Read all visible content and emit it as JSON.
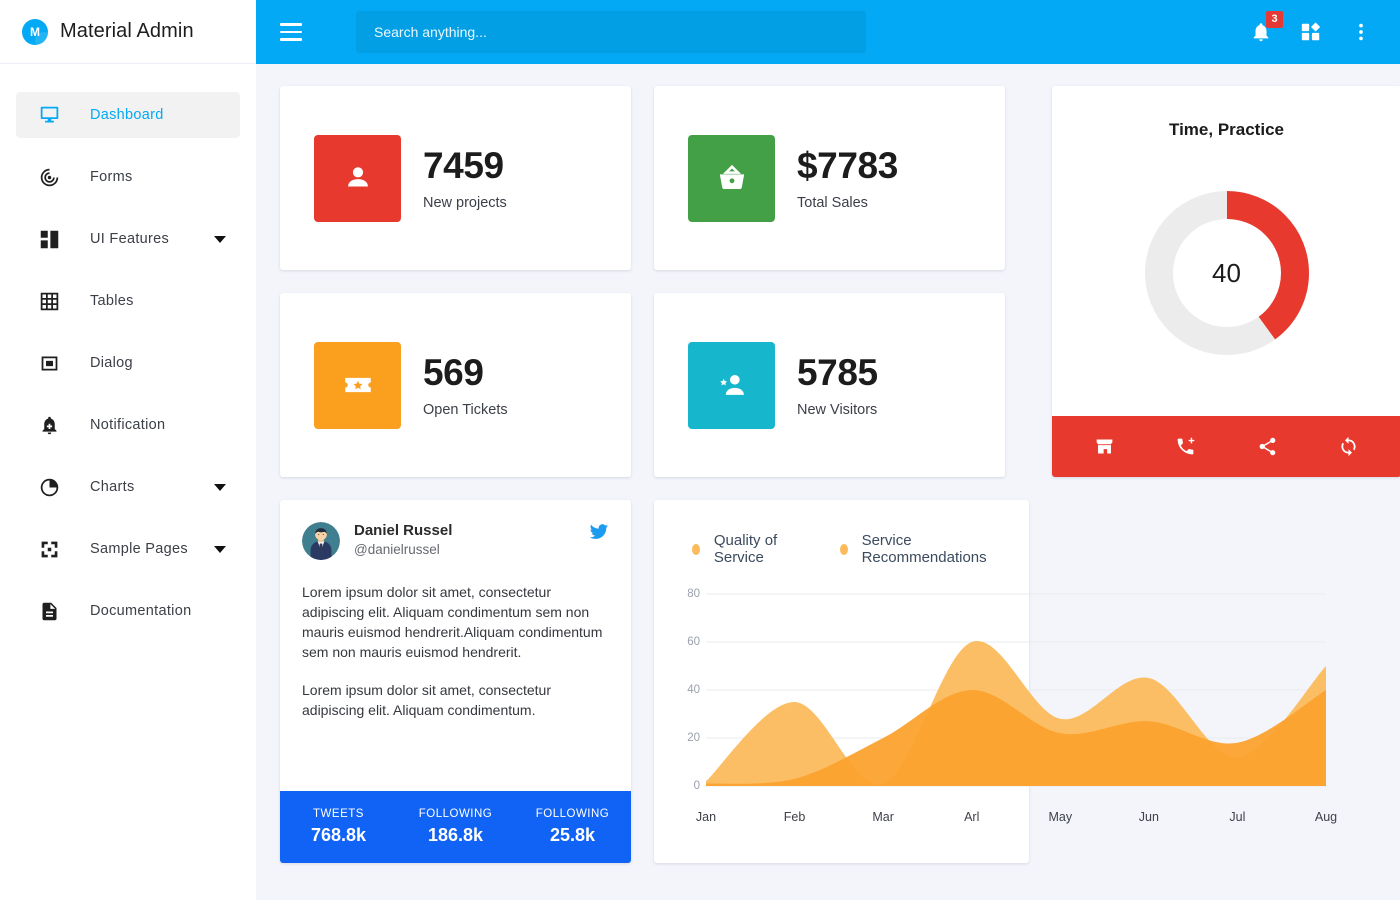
{
  "brand": {
    "logo_letter": "M",
    "title": "Material Admin"
  },
  "topnav": {
    "menu_icon": "hamburger-icon",
    "search": {
      "placeholder": "Search anything...",
      "value": ""
    },
    "notifications": {
      "icon": "bell-icon",
      "badge": "3"
    },
    "apps": {
      "icon": "apps-grid-icon"
    },
    "more": {
      "icon": "more-vertical-icon"
    },
    "bg": "#03a9f4"
  },
  "sidebar": {
    "items": [
      {
        "label": "Dashboard",
        "icon": "desktop-icon",
        "active": true,
        "caret": false
      },
      {
        "label": "Forms",
        "icon": "radio-wave-icon",
        "active": false,
        "caret": false
      },
      {
        "label": "UI Features",
        "icon": "grid-blocks-icon",
        "active": false,
        "caret": true
      },
      {
        "label": "Tables",
        "icon": "table-grid-icon",
        "active": false,
        "caret": false
      },
      {
        "label": "Dialog",
        "icon": "dialog-box-icon",
        "active": false,
        "caret": false
      },
      {
        "label": "Notification",
        "icon": "bell-plus-icon",
        "active": false,
        "caret": false
      },
      {
        "label": "Charts",
        "icon": "pie-chart-icon",
        "active": false,
        "caret": true
      },
      {
        "label": "Sample Pages",
        "icon": "fullscreen-icon",
        "active": false,
        "caret": true
      },
      {
        "label": "Documentation",
        "icon": "document-icon",
        "active": false,
        "caret": false
      }
    ]
  },
  "stats": [
    {
      "value": "7459",
      "label": "New projects",
      "icon": "person-group-icon",
      "color": "#e8392e"
    },
    {
      "value": "$7783",
      "label": "Total Sales",
      "icon": "basket-icon",
      "color": "#43a047"
    },
    {
      "value": "569",
      "label": "Open Tickets",
      "icon": "ticket-star-icon",
      "color": "#fa9f1e"
    },
    {
      "value": "5785",
      "label": "New Visitors",
      "icon": "person-star-icon",
      "color": "#16b6cc"
    }
  ],
  "donut_card": {
    "title": "Time, Practice",
    "center_value": "40",
    "actions": [
      {
        "icon": "store-icon"
      },
      {
        "icon": "add-call-icon"
      },
      {
        "icon": "share-icon"
      },
      {
        "icon": "sync-icon"
      }
    ],
    "accent": "#e8392e",
    "track": "#ececec"
  },
  "tweet_card": {
    "name": "Daniel Russel",
    "handle": "@danielrussel",
    "platform_icon": "twitter-bird-icon",
    "avatar_icon": "user-avatar",
    "body_1": "Lorem ipsum dolor sit amet, consectetur adipiscing elit. Aliquam condimentum sem non mauris euismod hendrerit.Aliquam condimentum sem non mauris euismod hendrerit.",
    "body_2": "Lorem ipsum dolor sit amet, consectetur adipiscing elit. Aliquam condimentum.",
    "stats": [
      {
        "key": "TWEETS",
        "value": "768.8k"
      },
      {
        "key": "FOLLOWING",
        "value": "186.8k"
      },
      {
        "key": "FOLLOWING",
        "value": "25.8k"
      }
    ],
    "footer_bg": "#1163f5"
  },
  "chart_data": {
    "type": "area",
    "title": "",
    "xlabel": "",
    "ylabel": "",
    "categories": [
      "Jan",
      "Feb",
      "Mar",
      "Arl",
      "May",
      "Jun",
      "Jul",
      "Aug"
    ],
    "yticks": [
      0,
      20,
      40,
      60,
      80
    ],
    "ylim": [
      0,
      80
    ],
    "grid": true,
    "legend_position": "top-left",
    "series": [
      {
        "name": "Quality of Service",
        "color": "#fcba5c",
        "values": [
          2,
          35,
          1,
          60,
          28,
          45,
          12,
          50
        ]
      },
      {
        "name": "Service Recommendations",
        "color": "#fca22e",
        "values": [
          1,
          3,
          20,
          40,
          22,
          27,
          18,
          40
        ]
      }
    ]
  },
  "colors": {
    "page_bg": "#f4f5fb",
    "sidebar_bg": "#ffffff",
    "primary": "#03a9f4"
  }
}
